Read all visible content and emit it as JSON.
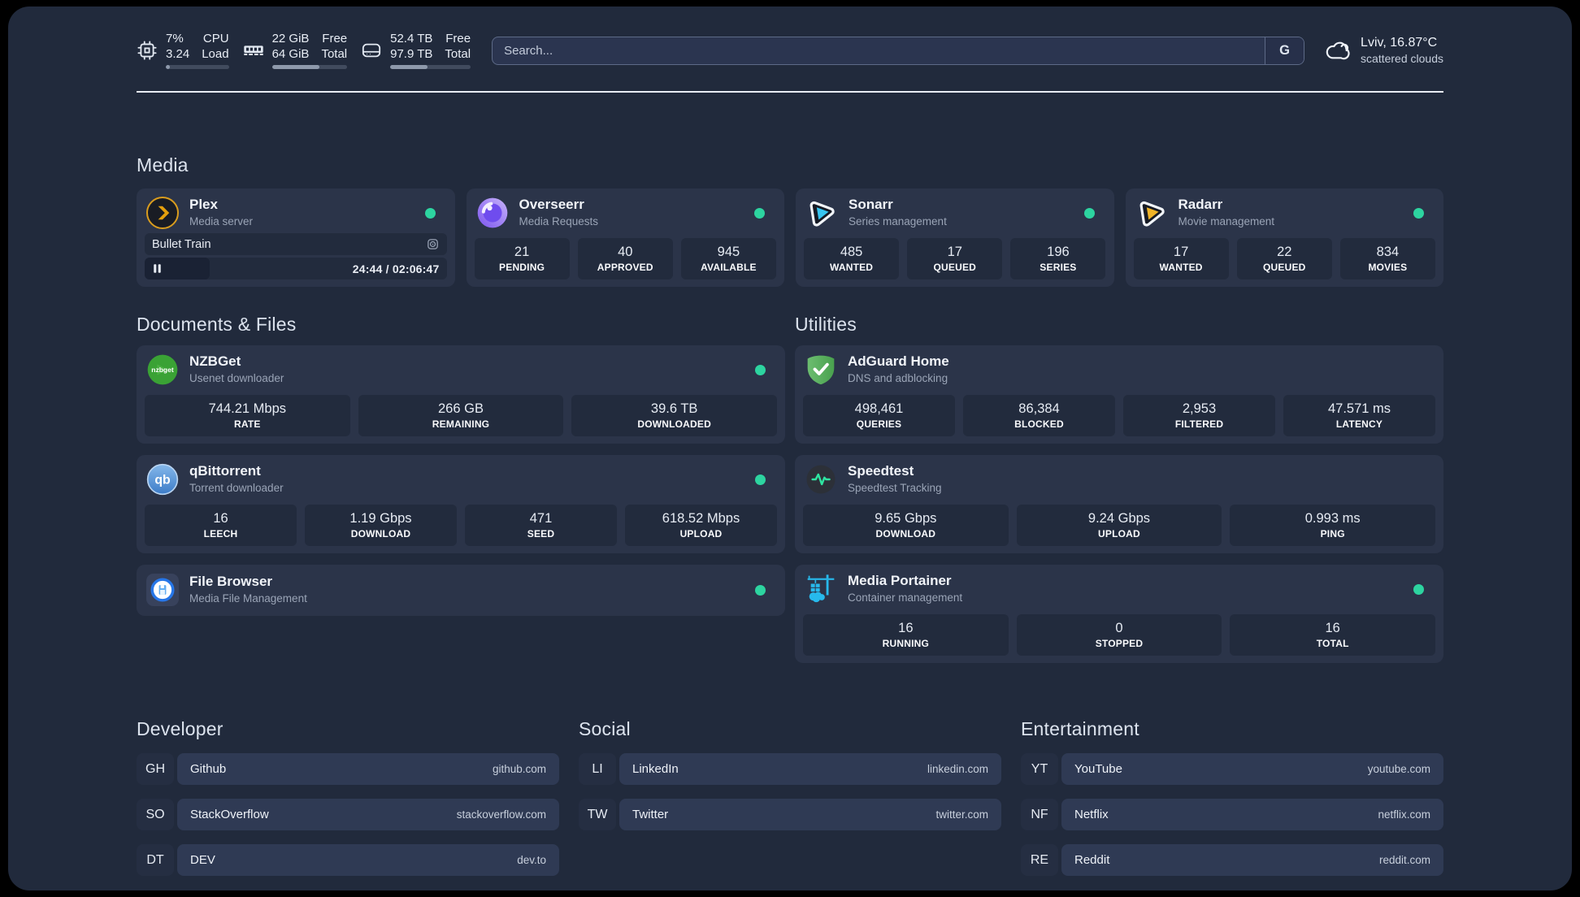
{
  "topbar": {
    "resources": [
      {
        "icon": "cpu-icon",
        "values": [
          "7%",
          "3.24"
        ],
        "labels": [
          "CPU",
          "Load"
        ],
        "percent": 7
      },
      {
        "icon": "memory-icon",
        "values": [
          "22 GiB",
          "64 GiB"
        ],
        "labels": [
          "Free",
          "Total"
        ],
        "percent": 63
      },
      {
        "icon": "disk-icon",
        "values": [
          "52.4 TB",
          "97.9 TB"
        ],
        "labels": [
          "Free",
          "Total"
        ],
        "percent": 46
      }
    ],
    "search": {
      "placeholder": "Search...",
      "provider": "G"
    },
    "weather": {
      "icon": "cloud-icon",
      "location_temp": "Lviv, 16.87°C",
      "condition": "scattered clouds"
    }
  },
  "media": {
    "title": "Media",
    "plex": {
      "icon": "plex-icon",
      "name": "Plex",
      "desc": "Media server",
      "now_playing": "Bullet Train",
      "time": "24:44 / 02:06:47"
    },
    "overseerr": {
      "icon": "overseerr-icon",
      "name": "Overseerr",
      "desc": "Media Requests",
      "stats": [
        {
          "value": "21",
          "label": "PENDING"
        },
        {
          "value": "40",
          "label": "APPROVED"
        },
        {
          "value": "945",
          "label": "AVAILABLE"
        }
      ]
    },
    "sonarr": {
      "icon": "sonarr-icon",
      "name": "Sonarr",
      "desc": "Series management",
      "stats": [
        {
          "value": "485",
          "label": "WANTED"
        },
        {
          "value": "17",
          "label": "QUEUED"
        },
        {
          "value": "196",
          "label": "SERIES"
        }
      ]
    },
    "radarr": {
      "icon": "radarr-icon",
      "name": "Radarr",
      "desc": "Movie management",
      "stats": [
        {
          "value": "17",
          "label": "WANTED"
        },
        {
          "value": "22",
          "label": "QUEUED"
        },
        {
          "value": "834",
          "label": "MOVIES"
        }
      ]
    }
  },
  "documents": {
    "title": "Documents & Files",
    "nzbget": {
      "icon": "nzbget-icon",
      "name": "NZBGet",
      "desc": "Usenet downloader",
      "stats": [
        {
          "value": "744.21 Mbps",
          "label": "RATE"
        },
        {
          "value": "266 GB",
          "label": "REMAINING"
        },
        {
          "value": "39.6 TB",
          "label": "DOWNLOADED"
        }
      ]
    },
    "qbittorrent": {
      "icon": "qbittorrent-icon",
      "name": "qBittorrent",
      "desc": "Torrent downloader",
      "stats": [
        {
          "value": "16",
          "label": "LEECH"
        },
        {
          "value": "1.19 Gbps",
          "label": "DOWNLOAD"
        },
        {
          "value": "471",
          "label": "SEED"
        },
        {
          "value": "618.52 Mbps",
          "label": "UPLOAD"
        }
      ]
    },
    "filebrowser": {
      "icon": "filebrowser-icon",
      "name": "File Browser",
      "desc": "Media File Management"
    }
  },
  "utilities": {
    "title": "Utilities",
    "adguard": {
      "icon": "adguard-icon",
      "name": "AdGuard Home",
      "desc": "DNS and adblocking",
      "stats": [
        {
          "value": "498,461",
          "label": "QUERIES"
        },
        {
          "value": "86,384",
          "label": "BLOCKED"
        },
        {
          "value": "2,953",
          "label": "FILTERED"
        },
        {
          "value": "47.571 ms",
          "label": "LATENCY"
        }
      ]
    },
    "speedtest": {
      "icon": "speedtest-icon",
      "name": "Speedtest",
      "desc": "Speedtest Tracking",
      "stats": [
        {
          "value": "9.65 Gbps",
          "label": "DOWNLOAD"
        },
        {
          "value": "9.24 Gbps",
          "label": "UPLOAD"
        },
        {
          "value": "0.993 ms",
          "label": "PING"
        }
      ]
    },
    "portainer": {
      "icon": "portainer-icon",
      "name": "Media Portainer",
      "desc": "Container management",
      "stats": [
        {
          "value": "16",
          "label": "RUNNING"
        },
        {
          "value": "0",
          "label": "STOPPED"
        },
        {
          "value": "16",
          "label": "TOTAL"
        }
      ]
    }
  },
  "links": {
    "developer": {
      "title": "Developer",
      "items": [
        {
          "abbr": "GH",
          "name": "Github",
          "url": "github.com"
        },
        {
          "abbr": "SO",
          "name": "StackOverflow",
          "url": "stackoverflow.com"
        },
        {
          "abbr": "DT",
          "name": "DEV",
          "url": "dev.to"
        }
      ]
    },
    "social": {
      "title": "Social",
      "items": [
        {
          "abbr": "LI",
          "name": "LinkedIn",
          "url": "linkedin.com"
        },
        {
          "abbr": "TW",
          "name": "Twitter",
          "url": "twitter.com"
        }
      ]
    },
    "entertainment": {
      "title": "Entertainment",
      "items": [
        {
          "abbr": "YT",
          "name": "YouTube",
          "url": "youtube.com"
        },
        {
          "abbr": "NF",
          "name": "Netflix",
          "url": "netflix.com"
        },
        {
          "abbr": "RE",
          "name": "Reddit",
          "url": "reddit.com"
        }
      ]
    }
  },
  "colors": {
    "status_online": "#2dd4a0",
    "plex_accent": "#e5a00d",
    "sonarr_accent": "#38c5f0",
    "radarr_accent": "#f0b429"
  }
}
